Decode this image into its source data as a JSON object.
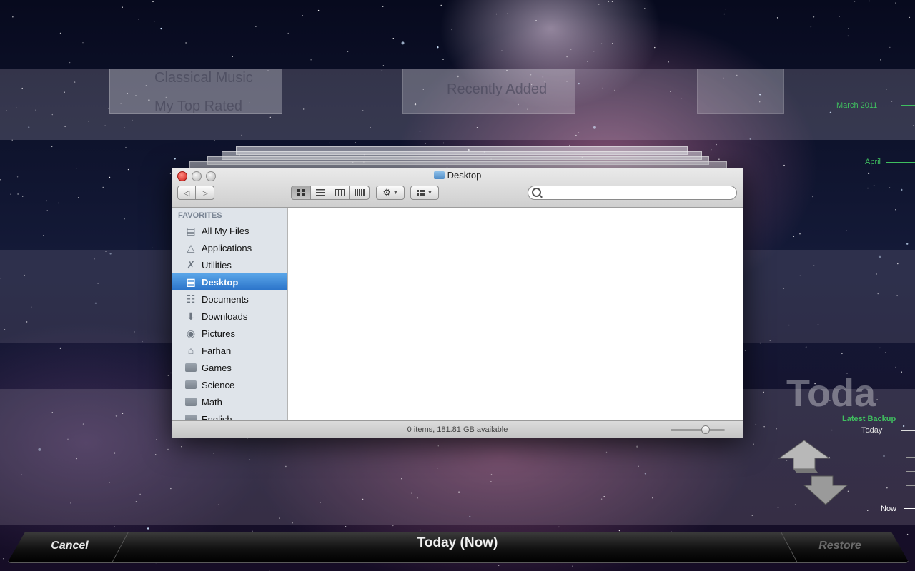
{
  "background": {
    "ghost_labels": [
      "Classical Music",
      "My Top Rated",
      "Recently Added",
      "Toda"
    ]
  },
  "finder": {
    "title": "Desktop",
    "search": {
      "placeholder": "",
      "value": ""
    },
    "sidebar": {
      "heading": "FAVORITES",
      "items": [
        {
          "label": "All My Files",
          "icon": "all-files-icon"
        },
        {
          "label": "Applications",
          "icon": "applications-icon"
        },
        {
          "label": "Utilities",
          "icon": "utilities-icon"
        },
        {
          "label": "Desktop",
          "icon": "desktop-icon",
          "selected": true
        },
        {
          "label": "Documents",
          "icon": "documents-icon"
        },
        {
          "label": "Downloads",
          "icon": "downloads-icon"
        },
        {
          "label": "Pictures",
          "icon": "pictures-icon"
        },
        {
          "label": "Farhan",
          "icon": "home-icon"
        },
        {
          "label": "Games",
          "icon": "folder-icon"
        },
        {
          "label": "Science",
          "icon": "folder-icon"
        },
        {
          "label": "Math",
          "icon": "folder-icon"
        },
        {
          "label": "English",
          "icon": "folder-icon"
        }
      ]
    },
    "status": "0 items, 181.81 GB available",
    "icon_size_slider": 0.65
  },
  "timeline": {
    "march": "March 2011",
    "april": "April",
    "latest_backup": "Latest Backup",
    "today": "Today",
    "now": "Now"
  },
  "bottom_bar": {
    "cancel": "Cancel",
    "title": "Today (Now)",
    "restore": "Restore"
  },
  "colors": {
    "accent_green": "#3fbf5f",
    "selection_blue": "#2a73c9",
    "close_red": "#d1201b"
  }
}
